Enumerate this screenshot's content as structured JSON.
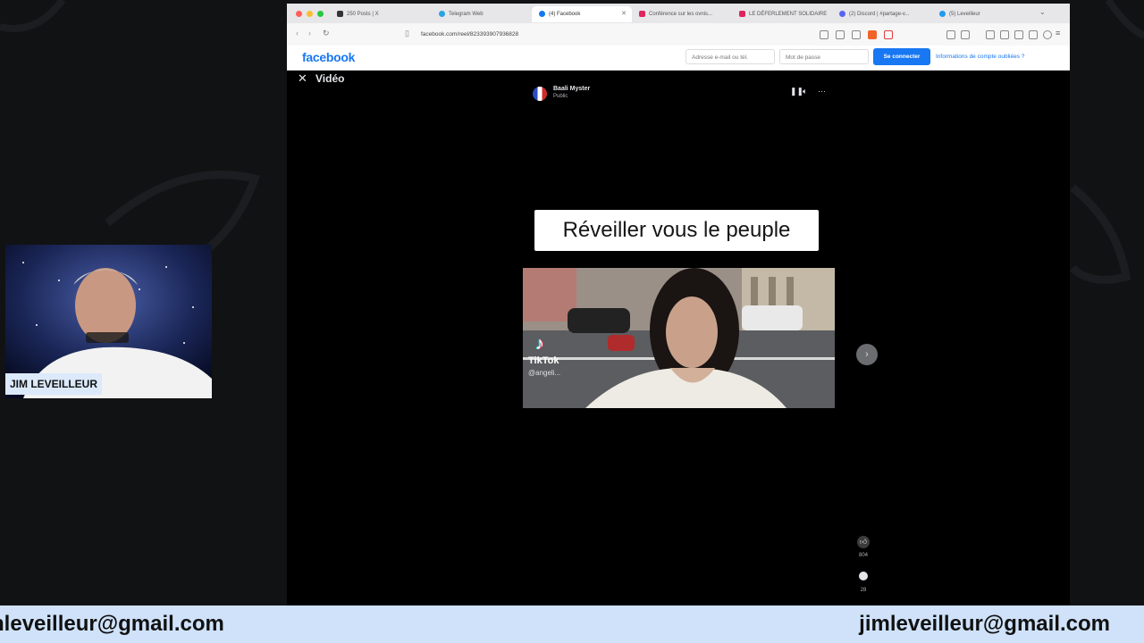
{
  "browser": {
    "tabs": [
      {
        "label": "250 Posts | X",
        "icon_color": "#333333",
        "active": false
      },
      {
        "label": "Telegram Web",
        "icon_color": "#2aa3e0",
        "active": false
      },
      {
        "label": "(4) Facebook",
        "icon_color": "#1877f2",
        "active": true
      },
      {
        "label": "Conférence sur les ovnis...",
        "icon_color": "#e0245e",
        "active": false
      },
      {
        "label": "LE DÉFERLEMENT SOLIDAIRE",
        "icon_color": "#e0245e",
        "active": false
      },
      {
        "label": "(2) Discord | #partage-v...",
        "icon_color": "#5865f2",
        "active": false
      },
      {
        "label": "(5) Leveilleur",
        "icon_color": "#1d9bf0",
        "active": false
      }
    ],
    "url": "facebook.com/reel/823393907936828"
  },
  "facebook": {
    "logo": "facebook",
    "email_placeholder": "Adresse e-mail ou tél.",
    "password_placeholder": "Mot de passe",
    "login_button": "Se connecter",
    "forgot_link": "Informations de compte oubliées ?",
    "video_label": "Vidéo",
    "author_name": "Baali Myster",
    "author_privacy": "Public",
    "caption": "Réveiller vous le peuple",
    "tiktok_text": "TikTok",
    "tiktok_user": "@angeli...",
    "like_count": "804",
    "comment_count": "28"
  },
  "presenter": {
    "name": "JIM LEVEILLEUR"
  },
  "banner": {
    "email_left": "jimleveilleur@gmail.com",
    "email_right": "jimleveilleur@gmail.com"
  }
}
